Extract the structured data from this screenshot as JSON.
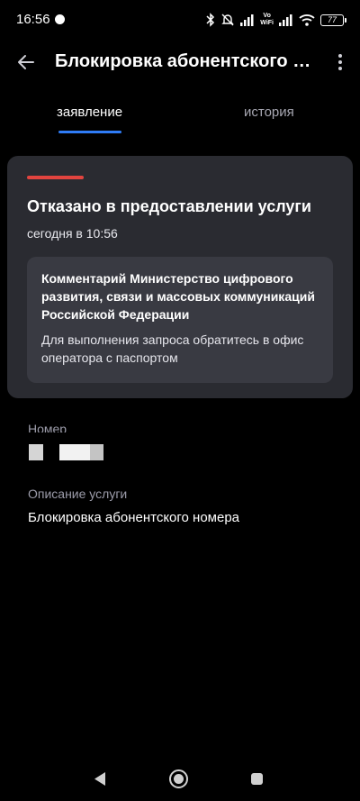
{
  "status_bar": {
    "time": "16:56",
    "vowifi_top": "Vo",
    "vowifi_bottom": "WiFi",
    "battery": "77",
    "icons": [
      "notification-dot-icon",
      "bluetooth-icon",
      "mute-icon",
      "signal-icon",
      "signal-icon",
      "wifi-icon",
      "battery-icon"
    ]
  },
  "header": {
    "title": "Блокировка абонентского н...",
    "back_icon": "arrow-left-icon",
    "menu_icon": "more-vertical-icon"
  },
  "tabs": [
    {
      "label": "заявление",
      "active": true
    },
    {
      "label": "история",
      "active": false
    }
  ],
  "status_card": {
    "accent_color": "#e2443f",
    "title": "Отказано в предоставлении услуги",
    "time": "сегодня в 10:56",
    "comment": {
      "heading": "Комментарий Министерство цифрового развития, связи и массовых коммуникаций Российской Федерации",
      "text": "Для выполнения запроса обратитесь в офис оператора с паспортом"
    }
  },
  "fields": {
    "number_label": "Номер",
    "description_label": "Описание услуги",
    "description_value": "Блокировка абонентского номера"
  },
  "colors": {
    "background": "#000000",
    "card": "#2a2b31",
    "comment_box": "#393a42",
    "tab_accent": "#2f7cf6"
  }
}
